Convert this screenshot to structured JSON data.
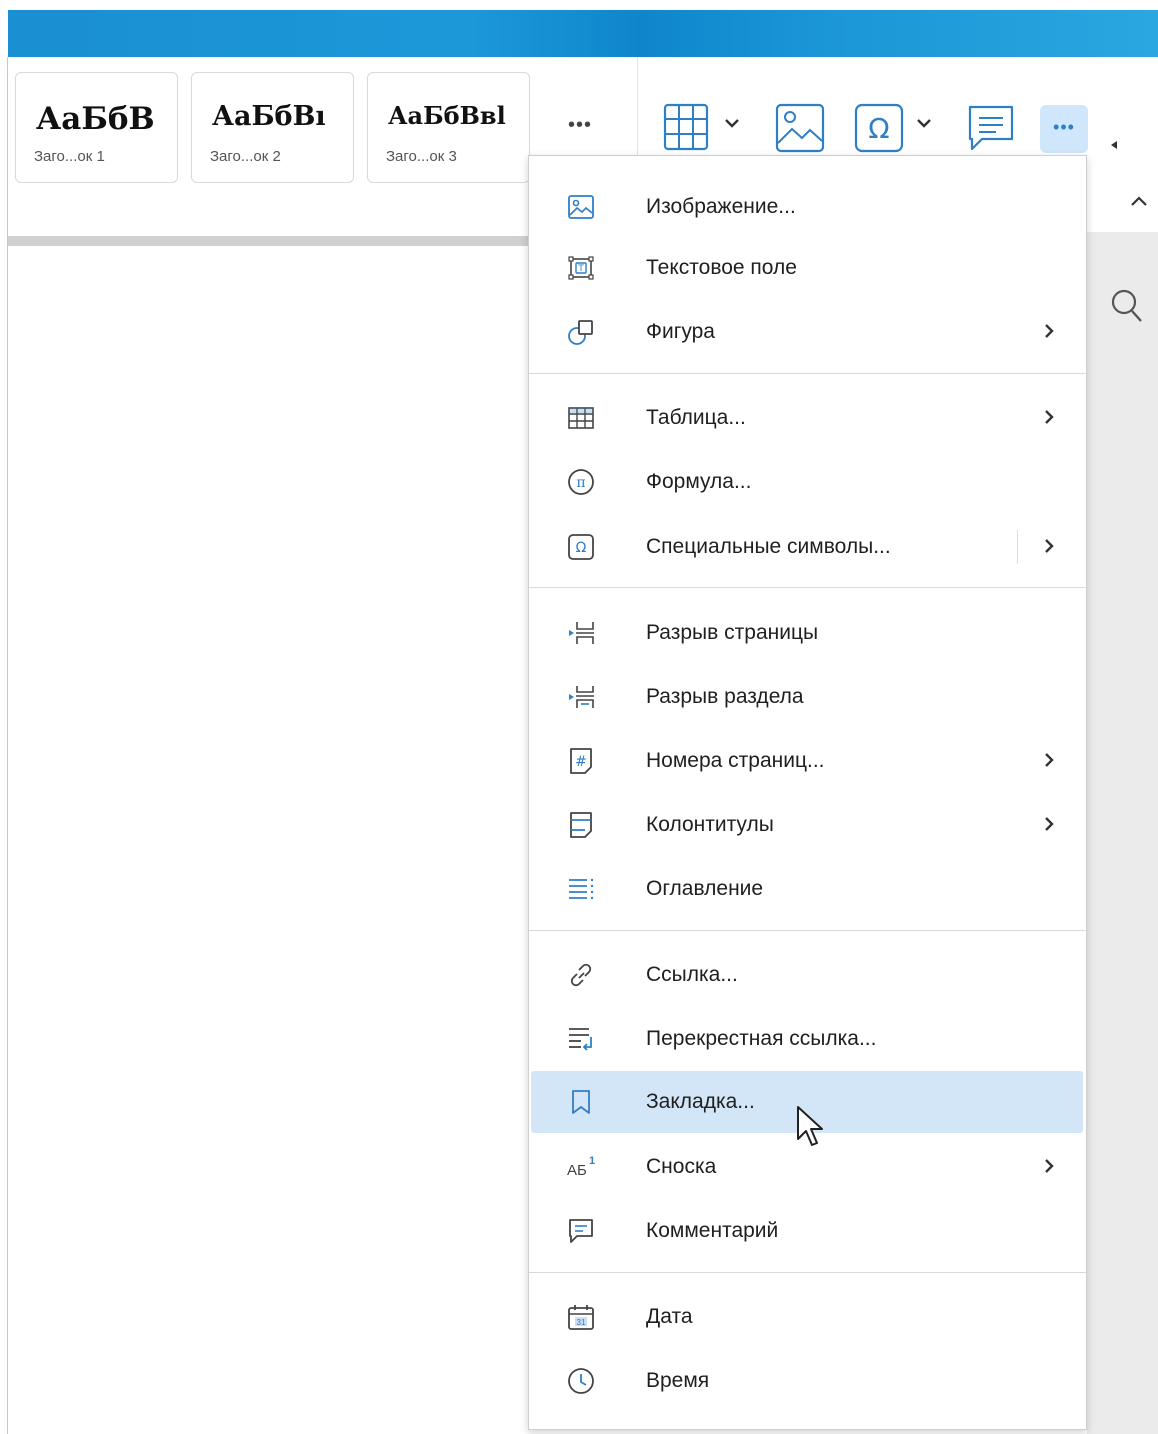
{
  "ribbon": {
    "styles": [
      {
        "sample": "АаБбВ",
        "label": "Заго...ок 1"
      },
      {
        "sample": "АаБбВı",
        "label": "Заго...ок 2"
      },
      {
        "sample": "АаБбВвl",
        "label": "Заго...ок 3"
      }
    ],
    "more_styles": "•••",
    "more_insert": "•••"
  },
  "menu": {
    "items": [
      {
        "label": "Изображение...",
        "icon": "image-icon"
      },
      {
        "label": "Текстовое поле",
        "icon": "text-box-icon"
      },
      {
        "label": "Фигура",
        "icon": "shape-icon",
        "submenu": true
      },
      {
        "label": "Таблица...",
        "icon": "table-icon",
        "submenu": true
      },
      {
        "label": "Формула...",
        "icon": "formula-icon"
      },
      {
        "label": "Специальные символы...",
        "icon": "omega-icon",
        "submenu": true,
        "split": true
      },
      {
        "label": "Разрыв страницы",
        "icon": "page-break-icon"
      },
      {
        "label": "Разрыв раздела",
        "icon": "section-break-icon"
      },
      {
        "label": "Номера страниц...",
        "icon": "page-numbers-icon",
        "submenu": true
      },
      {
        "label": "Колонтитулы",
        "icon": "header-footer-icon",
        "submenu": true
      },
      {
        "label": "Оглавление",
        "icon": "toc-icon"
      },
      {
        "label": "Ссылка...",
        "icon": "link-icon"
      },
      {
        "label": "Перекрестная ссылка...",
        "icon": "cross-reference-icon"
      },
      {
        "label": "Закладка...",
        "icon": "bookmark-icon",
        "highlighted": true
      },
      {
        "label": "Сноска",
        "icon": "footnote-icon",
        "submenu": true,
        "icon_text": "АБ",
        "icon_sup": "1"
      },
      {
        "label": "Комментарий",
        "icon": "comment-icon"
      },
      {
        "label": "Дата",
        "icon": "calendar-icon",
        "icon_text": "31"
      },
      {
        "label": "Время",
        "icon": "clock-icon"
      }
    ]
  },
  "colors": {
    "accent": "#1a8fd1",
    "highlight": "#d2e6f8",
    "icon_blue": "#2f7fc6"
  }
}
